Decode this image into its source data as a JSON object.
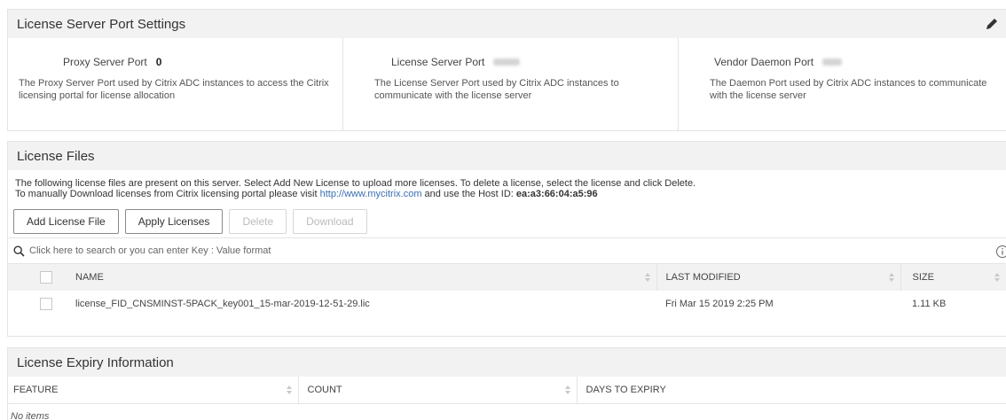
{
  "ports_section": {
    "title": "License Server Port Settings",
    "proxy": {
      "label": "Proxy Server Port",
      "value": "0",
      "description": "The Proxy Server Port used by Citrix ADC instances to access the Citrix licensing portal for license allocation"
    },
    "license_server": {
      "label": "License Server Port",
      "description": "The License Server Port used by Citrix ADC instances to communicate with the license server"
    },
    "vendor_daemon": {
      "label": "Vendor Daemon Port",
      "description": "The Daemon Port used by Citrix ADC instances to communicate with the license server"
    }
  },
  "files_section": {
    "title": "License Files",
    "info_line1": "The following license files are present on this server. Select Add New License to upload more licenses. To delete a license, select the license and click Delete.",
    "info_line2_prefix": "To manually Download licenses from Citrix licensing portal please visit ",
    "info_link": "http://www.mycitrix.com",
    "info_line2_mid": " and use the Host ID: ",
    "host_id": "ea:a3:66:04:a5:96",
    "buttons": {
      "add": "Add License File",
      "apply": "Apply Licenses",
      "delete": "Delete",
      "download": "Download"
    },
    "search_placeholder": "Click here to search or you can enter Key : Value format",
    "columns": {
      "name": "NAME",
      "modified": "LAST MODIFIED",
      "size": "SIZE"
    },
    "rows": [
      {
        "name": "license_FID_CNSMINST-5PACK_key001_15-mar-2019-12-51-29.lic",
        "modified": "Fri Mar 15 2019 2:25 PM",
        "size": "1.11 KB"
      }
    ]
  },
  "expiry_section": {
    "title": "License Expiry Information",
    "columns": {
      "feature": "FEATURE",
      "count": "COUNT",
      "days": "DAYS TO EXPIRY"
    },
    "empty": "No items"
  },
  "icons": {
    "edit": "pencil-icon",
    "search": "search-icon",
    "info": "info-icon",
    "sort": "sort-icon"
  }
}
